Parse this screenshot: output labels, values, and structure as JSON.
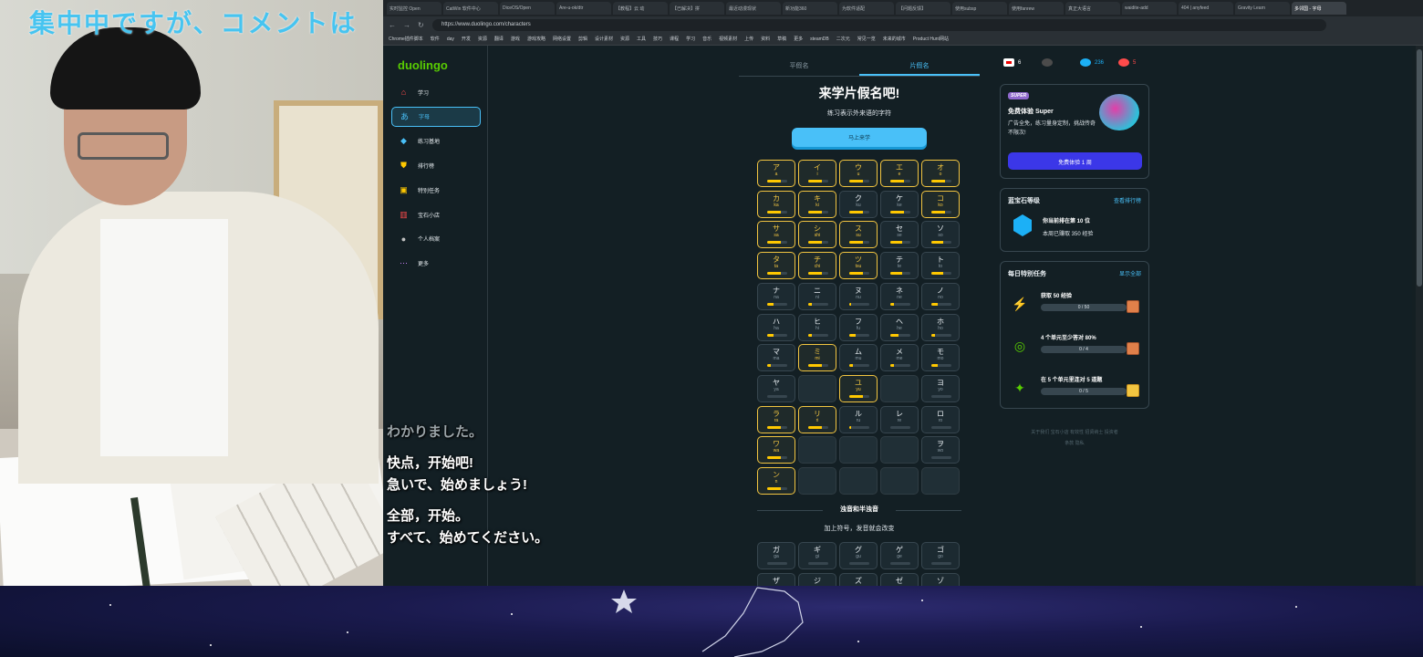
{
  "overlay": {
    "marquee": "集中中ですが、コメントは",
    "sub_line1": "わかりました。",
    "sub_line2": "快点，开始吧!",
    "sub_line3": "急いで、始めましょう!",
    "sub_line4": "全部，开始。",
    "sub_line5": "すべて、始めてください。"
  },
  "browser": {
    "tabs": [
      "实时监控 Open",
      "CatWin 软件中心",
      "DiceOS/Open",
      "Are-u-ok/dtr",
      "【教程】云 动",
      "【已解决】拼",
      "最近动漫现状",
      "新功能360",
      "为软件适配",
      "【问题反馈】",
      "使用subsp",
      "使用fanrew",
      "真正大语言",
      "waidite-add",
      "404 | anyfeed",
      "Gravity Learn",
      "多邻国 - 字母"
    ],
    "active_tab": 16,
    "url": "https://www.duolingo.com/characters",
    "bookmarks": [
      "Chrome插件脚本",
      "软件",
      "day",
      "开发",
      "资源",
      "翻译",
      "游戏",
      "游戏攻略",
      "网络设置",
      "剪辑",
      "设计素材",
      "资源",
      "工具",
      "技巧",
      "课程",
      "学习",
      "音乐",
      "视频素材",
      "上传",
      "资料",
      "草稿",
      "更多",
      "steamDB",
      "二次元",
      "常见一览",
      "未来的城市",
      "Product Hunt网站"
    ]
  },
  "sidebar": {
    "logo": "duolingo",
    "items": [
      {
        "label": "学习",
        "icon": "home-icon",
        "color": "#ff4b4b"
      },
      {
        "label": "字母",
        "icon": "kana-icon",
        "color": "#49c0f8"
      },
      {
        "label": "练习基地",
        "icon": "dumbbell-icon",
        "color": "#49c0f8"
      },
      {
        "label": "排行榜",
        "icon": "shield-icon",
        "color": "#ffc800"
      },
      {
        "label": "特别任务",
        "icon": "chest-icon",
        "color": "#ffc800"
      },
      {
        "label": "宝石小店",
        "icon": "shop-icon",
        "color": "#ff4b4b"
      },
      {
        "label": "个人档案",
        "icon": "avatar-icon",
        "color": "#c0c0c0"
      },
      {
        "label": "更多",
        "icon": "more-icon",
        "color": "#ce82ff"
      }
    ],
    "active": 1
  },
  "main": {
    "tabs": [
      "平假名",
      "片假名"
    ],
    "active_tab": 1,
    "title": "来学片假名吧!",
    "subtitle": "练习表示外来语的字符",
    "learn_button": "马上来学",
    "kana": [
      [
        {
          "k": "ア",
          "r": "a",
          "g": 1,
          "p": 0.7
        },
        {
          "k": "イ",
          "r": "i",
          "g": 1,
          "p": 0.7
        },
        {
          "k": "ウ",
          "r": "u",
          "g": 1,
          "p": 0.7
        },
        {
          "k": "エ",
          "r": "e",
          "g": 1,
          "p": 0.7
        },
        {
          "k": "オ",
          "r": "o",
          "g": 1,
          "p": 0.7
        }
      ],
      [
        {
          "k": "カ",
          "r": "ka",
          "g": 1,
          "p": 0.7
        },
        {
          "k": "キ",
          "r": "ki",
          "g": 1,
          "p": 0.7
        },
        {
          "k": "ク",
          "r": "ku",
          "g": 0,
          "p": 0.7
        },
        {
          "k": "ケ",
          "r": "ke",
          "g": 0,
          "p": 0.7
        },
        {
          "k": "コ",
          "r": "ko",
          "g": 1,
          "p": 0.7
        }
      ],
      [
        {
          "k": "サ",
          "r": "sa",
          "g": 1,
          "p": 0.7
        },
        {
          "k": "シ",
          "r": "shi",
          "g": 1,
          "p": 0.7
        },
        {
          "k": "ス",
          "r": "su",
          "g": 1,
          "p": 0.7
        },
        {
          "k": "セ",
          "r": "se",
          "g": 0,
          "p": 0.6
        },
        {
          "k": "ソ",
          "r": "so",
          "g": 0,
          "p": 0.6
        }
      ],
      [
        {
          "k": "タ",
          "r": "ta",
          "g": 1,
          "p": 0.7
        },
        {
          "k": "チ",
          "r": "chi",
          "g": 1,
          "p": 0.7
        },
        {
          "k": "ツ",
          "r": "tsu",
          "g": 1,
          "p": 0.7
        },
        {
          "k": "テ",
          "r": "te",
          "g": 0,
          "p": 0.6
        },
        {
          "k": "ト",
          "r": "to",
          "g": 0,
          "p": 0.6
        }
      ],
      [
        {
          "k": "ナ",
          "r": "na",
          "g": 0,
          "p": 0.3
        },
        {
          "k": "ニ",
          "r": "ni",
          "g": 0,
          "p": 0.2
        },
        {
          "k": "ヌ",
          "r": "nu",
          "g": 0,
          "p": 0.1
        },
        {
          "k": "ネ",
          "r": "ne",
          "g": 0,
          "p": 0.2
        },
        {
          "k": "ノ",
          "r": "no",
          "g": 0,
          "p": 0.3
        }
      ],
      [
        {
          "k": "ハ",
          "r": "ha",
          "g": 0,
          "p": 0.3
        },
        {
          "k": "ヒ",
          "r": "hi",
          "g": 0,
          "p": 0.2
        },
        {
          "k": "フ",
          "r": "fu",
          "g": 0,
          "p": 0.3
        },
        {
          "k": "ヘ",
          "r": "he",
          "g": 0,
          "p": 0.4
        },
        {
          "k": "ホ",
          "r": "ho",
          "g": 0,
          "p": 0.2
        }
      ],
      [
        {
          "k": "マ",
          "r": "ma",
          "g": 0,
          "p": 0.2
        },
        {
          "k": "ミ",
          "r": "mi",
          "g": 1,
          "p": 0.7
        },
        {
          "k": "ム",
          "r": "mu",
          "g": 0,
          "p": 0.2
        },
        {
          "k": "メ",
          "r": "me",
          "g": 0,
          "p": 0.2
        },
        {
          "k": "モ",
          "r": "mo",
          "g": 0,
          "p": 0.3
        }
      ],
      [
        {
          "k": "ヤ",
          "r": "ya",
          "g": 0,
          "p": 0.0
        },
        null,
        {
          "k": "ユ",
          "r": "yu",
          "g": 1,
          "p": 0.7
        },
        null,
        {
          "k": "ヨ",
          "r": "yo",
          "g": 0,
          "p": 0.0
        }
      ],
      [
        {
          "k": "ラ",
          "r": "ra",
          "g": 1,
          "p": 0.7
        },
        {
          "k": "リ",
          "r": "ri",
          "g": 1,
          "p": 0.7
        },
        {
          "k": "ル",
          "r": "ru",
          "g": 0,
          "p": 0.1
        },
        {
          "k": "レ",
          "r": "re",
          "g": 0,
          "p": 0.0
        },
        {
          "k": "ロ",
          "r": "ro",
          "g": 0,
          "p": 0.0
        }
      ],
      [
        {
          "k": "ワ",
          "r": "wa",
          "g": 1,
          "p": 0.7
        },
        null,
        null,
        null,
        {
          "k": "ヲ",
          "r": "wo",
          "g": 0,
          "p": 0.0
        }
      ],
      [
        {
          "k": "ン",
          "r": "n",
          "g": 1,
          "p": 0.7
        },
        null,
        null,
        null,
        null
      ]
    ],
    "dakuten_title": "浊音和半浊音",
    "dakuten_subtitle": "加上符号，发音就会改变",
    "dakuten": [
      [
        {
          "k": "ガ",
          "r": "ga",
          "g": 0,
          "p": 0
        },
        {
          "k": "ギ",
          "r": "gi",
          "g": 0,
          "p": 0
        },
        {
          "k": "グ",
          "r": "gu",
          "g": 0,
          "p": 0
        },
        {
          "k": "ゲ",
          "r": "ge",
          "g": 0,
          "p": 0
        },
        {
          "k": "ゴ",
          "r": "go",
          "g": 0,
          "p": 0
        }
      ],
      [
        {
          "k": "ザ",
          "r": "",
          "g": 0,
          "p": 0
        },
        {
          "k": "ジ",
          "r": "",
          "g": 0,
          "p": 0
        },
        {
          "k": "ズ",
          "r": "",
          "g": 0,
          "p": 0
        },
        {
          "k": "ゼ",
          "r": "",
          "g": 0,
          "p": 0
        },
        {
          "k": "ゾ",
          "r": "",
          "g": 0,
          "p": 0
        }
      ]
    ]
  },
  "stats": {
    "streak": "6",
    "gems": "236",
    "hearts": "5"
  },
  "super_card": {
    "badge": "SUPER",
    "title": "免费体验 Super",
    "desc": "广告全免，练习量身定制，挑战传奇不限次!",
    "button": "免费体验 1 周"
  },
  "league": {
    "title": "蓝宝石等级",
    "link": "查看排行榜",
    "rank": "你当前排在第 10 位",
    "xp": "本周已赚取 350 经验"
  },
  "quests": {
    "title": "每日特别任务",
    "link": "显示全部",
    "items": [
      {
        "name": "获取 50 经验",
        "progress": "0 / 50",
        "icon": "⚡",
        "fraction": 0
      },
      {
        "name": "4 个单元至少答对 80%",
        "progress": "0 / 4",
        "icon": "◎",
        "fraction": 0
      },
      {
        "name": "在 5 个单元里连对 5 道题",
        "progress": "0 / 5",
        "icon": "✦",
        "fraction": 0
      }
    ]
  },
  "footer": {
    "line1": "关于我们  宝石小店  有效性  招贤纳士  投资者",
    "line2": "条款  隐私"
  }
}
